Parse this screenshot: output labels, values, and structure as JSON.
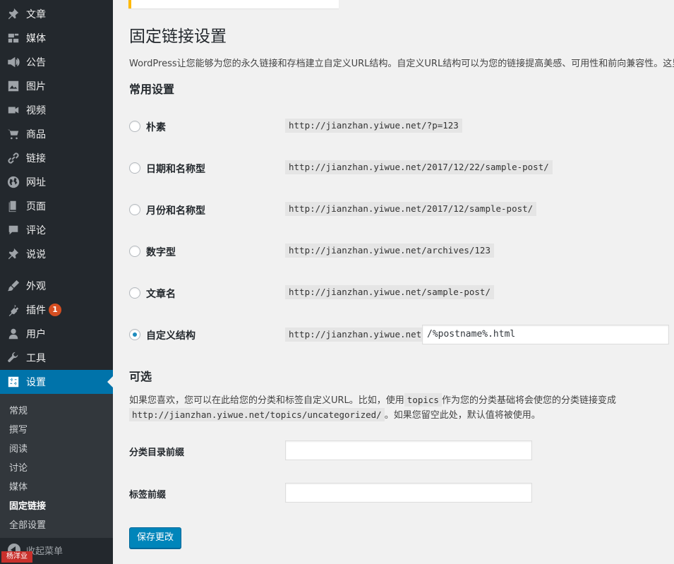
{
  "sidebar": {
    "items": [
      {
        "label": "文章",
        "icon": "pin-icon"
      },
      {
        "label": "媒体",
        "icon": "media-icon"
      },
      {
        "label": "公告",
        "icon": "megaphone-icon"
      },
      {
        "label": "图片",
        "icon": "image-icon"
      },
      {
        "label": "视频",
        "icon": "video-icon"
      },
      {
        "label": "商品",
        "icon": "cart-icon"
      },
      {
        "label": "链接",
        "icon": "link-icon"
      },
      {
        "label": "网址",
        "icon": "globe-icon"
      },
      {
        "label": "页面",
        "icon": "page-icon"
      },
      {
        "label": "评论",
        "icon": "comment-icon"
      },
      {
        "label": "说说",
        "icon": "pin-icon"
      },
      {
        "label": "外观",
        "icon": "brush-icon"
      },
      {
        "label": "插件",
        "icon": "plugin-icon",
        "badge": "1"
      },
      {
        "label": "用户",
        "icon": "user-icon"
      },
      {
        "label": "工具",
        "icon": "wrench-icon"
      },
      {
        "label": "设置",
        "icon": "settings-icon",
        "active": true
      }
    ],
    "submenu": [
      "常规",
      "撰写",
      "阅读",
      "讨论",
      "媒体",
      "固定链接",
      "全部设置"
    ],
    "submenu_current": "固定链接",
    "collapse_label": "收起菜单",
    "watermark": "杨洋业"
  },
  "page": {
    "title": "固定链接设置",
    "intro": "WordPress让您能够为您的永久链接和存档建立自定义URL结构。自定义URL结构可以为您的链接提高美感、可用性和前向兼容性。这里"
  },
  "common": {
    "title": "常用设置",
    "options": [
      {
        "label": "朴素",
        "code": "http://jianzhan.yiwue.net/?p=123",
        "checked": false
      },
      {
        "label": "日期和名称型",
        "code": "http://jianzhan.yiwue.net/2017/12/22/sample-post/",
        "checked": false
      },
      {
        "label": "月份和名称型",
        "code": "http://jianzhan.yiwue.net/2017/12/sample-post/",
        "checked": false
      },
      {
        "label": "数字型",
        "code": "http://jianzhan.yiwue.net/archives/123",
        "checked": false
      },
      {
        "label": "文章名",
        "code": "http://jianzhan.yiwue.net/sample-post/",
        "checked": false
      },
      {
        "label": "自定义结构",
        "code": "http://jianzhan.yiwue.net",
        "checked": true,
        "input_value": "/%postname%.html"
      }
    ]
  },
  "optional": {
    "title": "可选",
    "desc_line1_before": "如果您喜欢，您可以在此给您的分类和标签自定义URL。比如，使用",
    "desc_code1": "topics",
    "desc_line1_after": "作为您的分类基础将会使您的分类链接变成",
    "desc_code2": "http://jianzhan.yiwue.net/topics/uncategorized/",
    "desc_line2_after": "。如果您留空此处，默认值将被使用。",
    "category_label": "分类目录前缀",
    "category_value": "",
    "tag_label": "标签前缀",
    "tag_value": ""
  },
  "save_label": "保存更改",
  "colors": {
    "sidebar_bg": "#23282d",
    "active_bg": "#0073aa",
    "submenu_bg": "#32373c",
    "button_bg": "#0085ba",
    "notice_border": "#ffb900",
    "badge_bg": "#d54e21"
  }
}
